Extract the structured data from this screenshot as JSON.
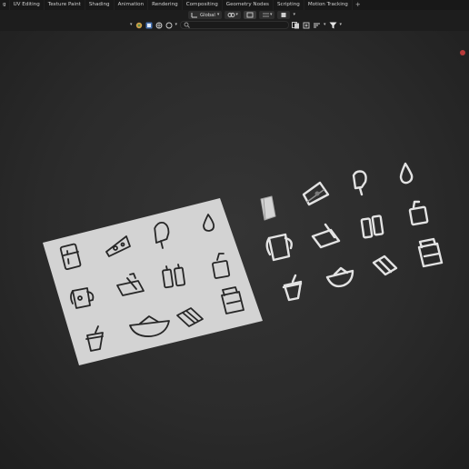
{
  "workspace_tabs": {
    "first": "g",
    "items": [
      "UV Editing",
      "Texture Paint",
      "Shading",
      "Animation",
      "Rendering",
      "Compositing",
      "Geometry Nodes",
      "Scripting",
      "Motion Tracking"
    ],
    "add": "+"
  },
  "header": {
    "transform_orientation": "Global",
    "search_placeholder": ""
  },
  "colors": {
    "viewport": "#2c2c2c",
    "plate": "#d3d3d3",
    "icon_stroke": "#262626",
    "model": "#cfcfcf",
    "accent_red": "#b73a3a"
  },
  "plate_icons": [
    "fridge-icon",
    "cheese-icon",
    "popsicle-icon",
    "drop-icon",
    "pitcher-icon",
    "butter-icon",
    "bottles-icon",
    "juice-box-icon",
    "cup-icon",
    "bowl-icon",
    "chocolate-icon",
    "jar-icon"
  ],
  "model_icons": [
    "fridge-model",
    "cheese-model",
    "popsicle-model",
    "drop-model",
    "pitcher-model",
    "butter-model",
    "bottles-model",
    "juice-box-model",
    "cup-model",
    "bowl-model",
    "chocolate-model",
    "jar-model"
  ]
}
